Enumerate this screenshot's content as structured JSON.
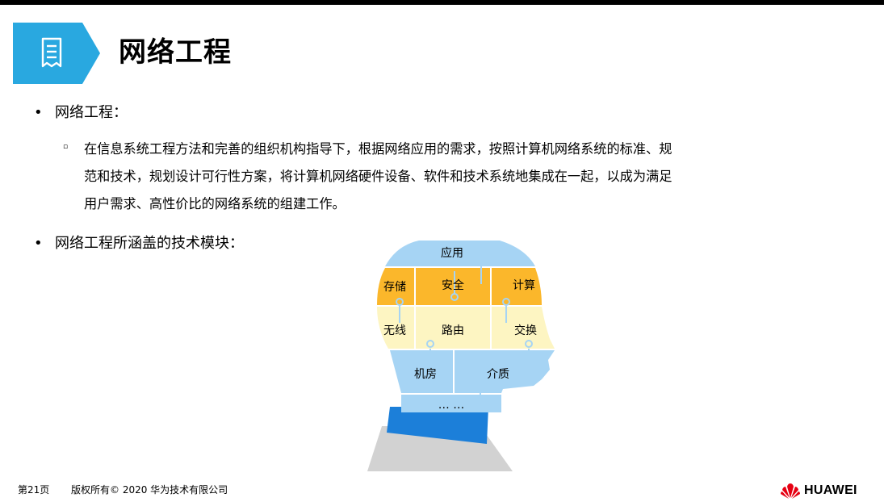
{
  "header": {
    "title": "网络工程",
    "icon": "document-icon",
    "accent_color": "#29a8e0"
  },
  "content": {
    "bullet_symbol": "•",
    "bullet1": "网络工程：",
    "sub_marker": "▫",
    "sub_paragraph": "在信息系统工程方法和完善的组织机构指导下，根据网络应用的需求，按照计算机网络系统的标准、规\n范和技术，规划设计可行性方案，将计算机网络硬件设备、软件和技术系统地集成在一起，以成为满足\n用户需求、高性价比的网络系统的组建工作。",
    "bullet2": "网络工程所涵盖的技术模块："
  },
  "diagram": {
    "modules": {
      "application": "应用",
      "storage": "存储",
      "security": "安全",
      "computing": "计算",
      "wireless": "无线",
      "routing": "路由",
      "switching": "交换",
      "datacenter": "机房",
      "medium": "介质",
      "more": "… …"
    },
    "colors": {
      "blue": "#a6d4f4",
      "orange": "#fbb72b",
      "yellow": "#fdf5c2",
      "collar": "#1c7fd9",
      "shirt": "#d2d2d2"
    }
  },
  "footer": {
    "page": "第21页",
    "copyright": "版权所有© 2020 华为技术有限公司",
    "brand": "HUAWEI",
    "logo_color": "#e60012"
  }
}
